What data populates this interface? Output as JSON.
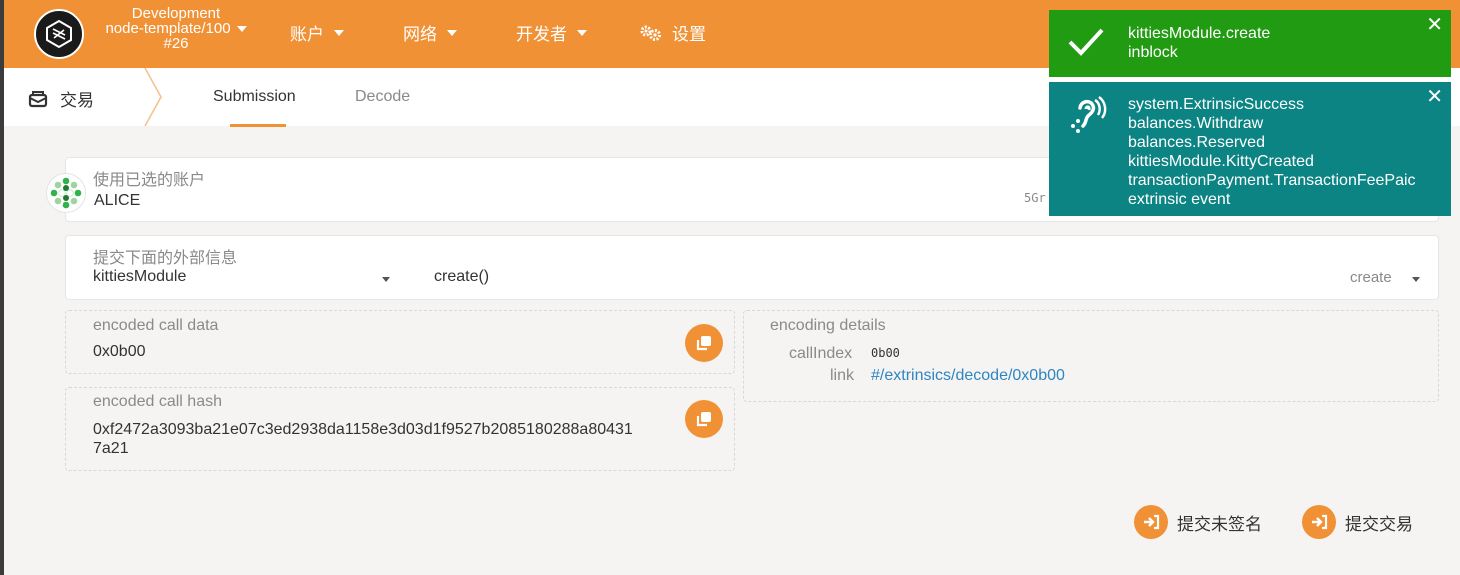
{
  "header": {
    "network_name": "Development",
    "node": "node-template/100",
    "block": "#26",
    "nav": [
      {
        "label": "账户"
      },
      {
        "label": "网络"
      },
      {
        "label": "开发者"
      },
      {
        "label": "设置"
      }
    ]
  },
  "subnav": {
    "title": "交易",
    "tabs": [
      {
        "label": "Submission",
        "active": true
      },
      {
        "label": "Decode",
        "active": false
      }
    ]
  },
  "account": {
    "label": "使用已选的账户",
    "name": "ALICE",
    "address_fragment": "5Gr"
  },
  "extrinsic": {
    "label": "提交下面的外部信息",
    "module": "kittiesModule",
    "call": "create()",
    "call_name": "create"
  },
  "encoded_call_data": {
    "label": "encoded call data",
    "value": "0x0b00"
  },
  "encoded_call_hash": {
    "label": "encoded call hash",
    "value_line1": "0xf2472a3093ba21e07c3ed2938da1158e3d03d1f9527b2085180288a80431",
    "value_line2": "7a21"
  },
  "encoding_details": {
    "label": "encoding details",
    "call_index_label": "callIndex",
    "call_index_value": "0b00",
    "link_label": "link",
    "link_value": "#/extrinsics/decode/0x0b00"
  },
  "actions": {
    "submit_unsigned": "提交未签名",
    "submit_transaction": "提交交易"
  },
  "toasts": {
    "inblock": {
      "line1": "kittiesModule.create",
      "line2": "inblock"
    },
    "events": {
      "lines": [
        "system.ExtrinsicSuccess",
        "balances.Withdraw",
        "balances.Reserved",
        "kittiesModule.KittyCreated",
        "transactionPayment.TransactionFeePaic",
        "extrinsic event"
      ]
    }
  },
  "colors": {
    "accent": "#f19135",
    "success": "#219b11",
    "info": "#0b8483",
    "link": "#2e86c1"
  }
}
